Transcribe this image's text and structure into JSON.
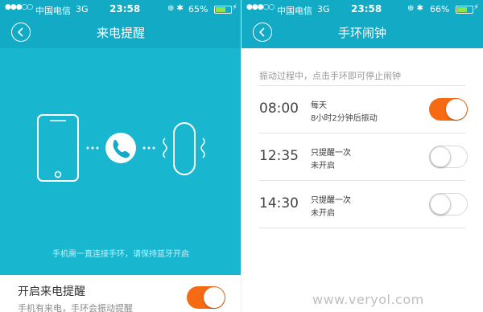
{
  "left": {
    "status": {
      "signal": "●●●○○",
      "carrier": "中国电信",
      "network": "3G",
      "time": "23:58",
      "battery": "65%",
      "battery_level": 65
    },
    "title": "来电提醒",
    "hint": "手机需一直连接手环，请保持蓝牙开启",
    "toggle": {
      "title": "开启来电提醒",
      "desc": "手机有来电，手环会振动提醒",
      "on": true
    }
  },
  "right": {
    "status": {
      "signal": "●●●○○",
      "carrier": "中国电信",
      "network": "3G",
      "time": "23:58",
      "battery": "66%",
      "battery_level": 66
    },
    "title": "手环闹钟",
    "caption": "振动过程中，点击手环即可停止闹钟",
    "alarms": [
      {
        "time": "08:00",
        "label": "每天",
        "sub": "8小时2分钟后振动",
        "on": true
      },
      {
        "time": "12:35",
        "label": "只提醒一次",
        "sub": "未开启",
        "on": false
      },
      {
        "time": "14:30",
        "label": "只提醒一次",
        "sub": "未开启",
        "on": false
      }
    ]
  },
  "watermark": "www.veryol.com",
  "colors": {
    "primary": "#12aac5",
    "accent": "#f56a13"
  }
}
